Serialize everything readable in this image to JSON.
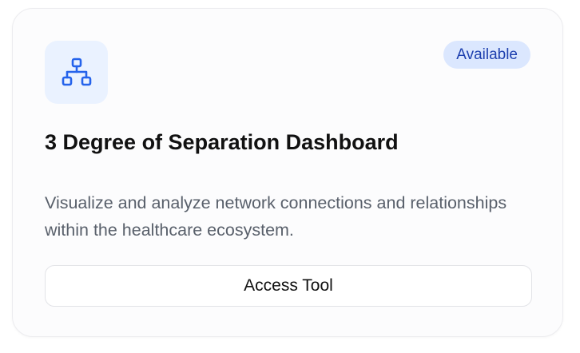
{
  "card": {
    "icon": "network-hierarchy-icon",
    "badge": "Available",
    "title": "3 Degree of Separation Dashboard",
    "description": "Visualize and analyze network connections and relationships within the healthcare ecosystem.",
    "button_label": "Access Tool"
  },
  "colors": {
    "accent": "#2563eb",
    "icon_tile_bg": "#eaf2ff",
    "badge_bg": "#dbe7fe",
    "badge_text": "#1e40af",
    "title": "#111111",
    "description": "#59606b"
  }
}
